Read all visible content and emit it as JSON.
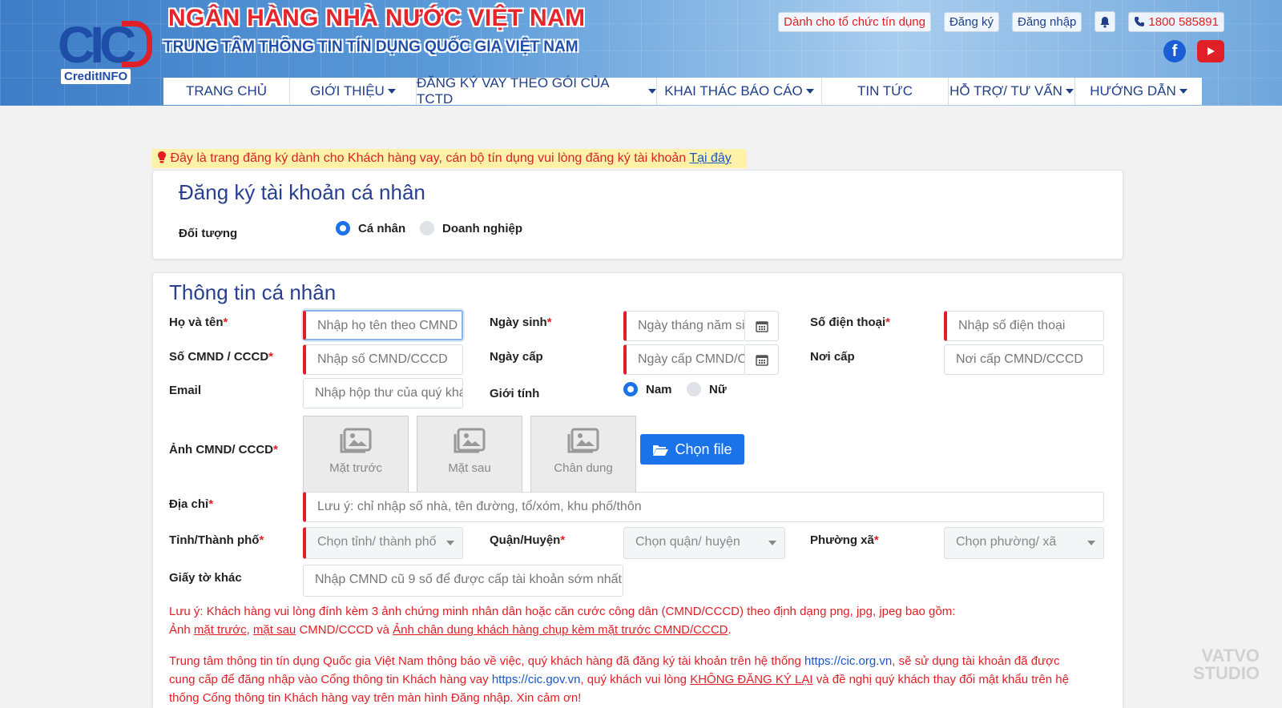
{
  "header": {
    "logo_text": "CIC",
    "logo_sub": "CreditINFO",
    "title": "NGÂN HÀNG NHÀ NƯỚC VIỆT NAM",
    "subtitle": "TRUNG TÂM THÔNG TIN TÍN DỤNG QUỐC GIA VIỆT NAM",
    "links": {
      "credit_orgs": "Dành cho tổ chức tín dụng",
      "register": "Đăng ký",
      "login": "Đăng nhập",
      "hotline": "1800 585891"
    }
  },
  "nav": [
    {
      "label": "TRANG CHỦ",
      "caret": false
    },
    {
      "label": "GIỚI THIỆU",
      "caret": true
    },
    {
      "label": "ĐĂNG KÝ VAY THEO GÓI CỦA TCTD",
      "caret": true
    },
    {
      "label": "KHAI THÁC BÁO CÁO",
      "caret": true
    },
    {
      "label": "TIN TỨC",
      "caret": false
    },
    {
      "label": "HỖ TRỢ/ TƯ VẤN",
      "caret": true
    },
    {
      "label": "HƯỚNG DẪN",
      "caret": true
    }
  ],
  "notice": {
    "text": "Đây là trang đăng ký dành cho Khách hàng vay, cán bộ tín dụng vui lòng đăng ký tài khoản ",
    "link": "Tại đây"
  },
  "account": {
    "title": "Đăng ký tài khoản cá nhân",
    "subject_label": "Đối tượng",
    "options": [
      "Cá nhân",
      "Doanh nghiệp"
    ],
    "selected": "Cá nhân"
  },
  "personal": {
    "title": "Thông tin cá nhân",
    "fullname": {
      "label": "Họ và tên",
      "placeholder": "Nhập họ tên theo CMND"
    },
    "dob": {
      "label": "Ngày sinh",
      "placeholder": "Ngày tháng năm sinh"
    },
    "phone": {
      "label": "Số điện thoại",
      "placeholder": "Nhập số điện thoại"
    },
    "id_number": {
      "label": "Số CMND / CCCD",
      "placeholder": "Nhập số CMND/CCCD"
    },
    "issue_date": {
      "label": "Ngày cấp",
      "placeholder": "Ngày cấp CMND/CCCD"
    },
    "issue_place": {
      "label": "Nơi cấp",
      "placeholder": "Nơi cấp CMND/CCCD"
    },
    "email": {
      "label": "Email",
      "placeholder": "Nhập hộp thư của quý khách"
    },
    "gender": {
      "label": "Giới tính",
      "options": [
        "Nam",
        "Nữ"
      ],
      "selected": "Nam"
    },
    "id_photo": {
      "label": "Ảnh CMND/ CCCD",
      "boxes": [
        "Mặt trước",
        "Mặt sau",
        "Chân dung"
      ],
      "button": "Chọn file"
    },
    "address": {
      "label": "Địa chỉ",
      "placeholder": "Lưu ý: chỉ nhập số nhà, tên đường, tổ/xóm, khu phố/thôn"
    },
    "province": {
      "label": "Tỉnh/Thành phố",
      "placeholder": "Chọn tỉnh/ thành phố"
    },
    "district": {
      "label": "Quận/Huyện",
      "placeholder": "Chọn quận/ huyện"
    },
    "ward": {
      "label": "Phường xã",
      "placeholder": "Chọn phường/ xã"
    },
    "other_doc": {
      "label": "Giấy tờ khác",
      "placeholder": "Nhập CMND cũ 9 số để được cấp tài khoản sớm nhất"
    }
  },
  "notes": {
    "n1_line1": "Lưu ý: Khách hàng vui lòng đính kèm 3 ảnh chứng minh nhân dân hoặc căn cước công dân (CMND/CCCD) theo định dạng png, jpg, jpeg bao gồm:",
    "n1_a": "Ảnh ",
    "n1_front": "mặt trước",
    "n1_comma": ", ",
    "n1_back": "mặt sau",
    "n1_mid": " CMND/CCCD và ",
    "n1_portrait": "Ảnh chân dung khách hàng chụp kèm mặt trước CMND/CCCD",
    "n1_end": ".",
    "n2_a": "Trung tâm thông tin tín dụng Quốc gia Việt Nam thông báo về việc, quý khách hàng đã đăng ký tài khoản trên hệ thống ",
    "n2_url1": "https://cic.org.vn",
    "n2_b": ", sẽ sử dụng tài khoản đã được",
    "n2_c": "cung cấp để đăng nhập vào Cổng thông tin Khách hàng vay ",
    "n2_url2": "https://cic.gov.vn",
    "n2_d": ", quý khách vui lòng ",
    "n2_no": "KHÔNG ĐĂNG KÝ LẠI",
    "n2_e": " và đề nghị quý khách thay đổi mật khẩu trên hệ",
    "n2_f": "thống Cổng thông tin Khách hàng vay trên màn hình Đăng nhập. Xin cảm ơn!"
  },
  "watermark": {
    "line1": "VATVO",
    "line2": "STUDIO"
  },
  "colors": {
    "primary": "#1a73e8",
    "brand_red": "#e01f26",
    "brand_blue": "#28408f"
  }
}
